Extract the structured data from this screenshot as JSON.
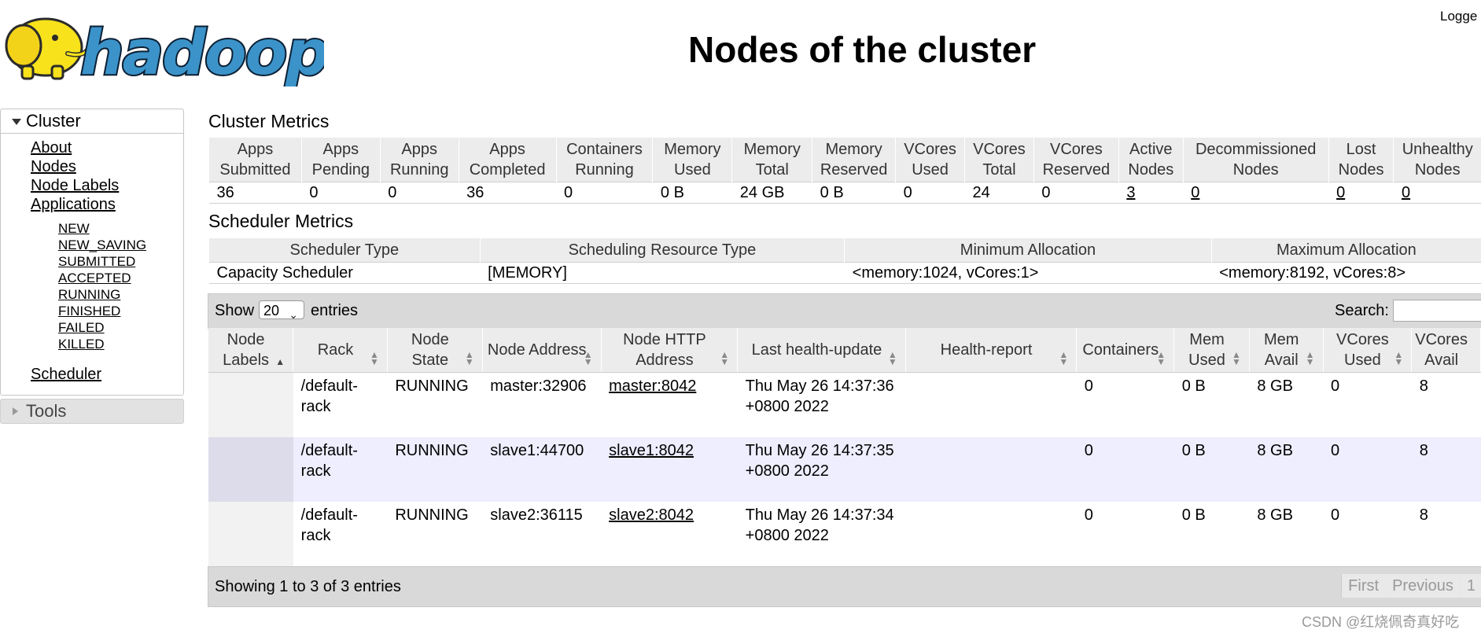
{
  "header": {
    "logo_text": "hadoop",
    "title": "Nodes of the cluster",
    "logged_in": "Logge"
  },
  "nav": {
    "cluster_label": "Cluster",
    "links": [
      "About",
      "Nodes",
      "Node Labels",
      "Applications"
    ],
    "app_states": [
      "NEW",
      "NEW_SAVING",
      "SUBMITTED",
      "ACCEPTED",
      "RUNNING",
      "FINISHED",
      "FAILED",
      "KILLED"
    ],
    "scheduler": "Scheduler",
    "tools_label": "Tools"
  },
  "cluster_metrics": {
    "title": "Cluster Metrics",
    "headers": [
      "Apps Submitted",
      "Apps Pending",
      "Apps Running",
      "Apps Completed",
      "Containers Running",
      "Memory Used",
      "Memory Total",
      "Memory Reserved",
      "VCores Used",
      "VCores Total",
      "VCores Reserved",
      "Active Nodes",
      "Decommissioned Nodes",
      "Lost Nodes",
      "Unhealthy Nodes"
    ],
    "values": [
      "36",
      "0",
      "0",
      "36",
      "0",
      "0 B",
      "24 GB",
      "0 B",
      "0",
      "24",
      "0",
      "3",
      "0",
      "0",
      "0"
    ]
  },
  "scheduler_metrics": {
    "title": "Scheduler Metrics",
    "headers": [
      "Scheduler Type",
      "Scheduling Resource Type",
      "Minimum Allocation",
      "Maximum Allocation"
    ],
    "values": [
      "Capacity Scheduler",
      "[MEMORY]",
      "<memory:1024, vCores:1>",
      "<memory:8192, vCores:8>"
    ]
  },
  "nodes_table": {
    "show_label": "Show",
    "page_size": "20",
    "entries_label": "entries",
    "search_label": "Search:",
    "search_value": "",
    "headers": [
      "Node Labels",
      "Rack",
      "Node State",
      "Node Address",
      "Node HTTP Address",
      "Last health-update",
      "Health-report",
      "Containers",
      "Mem Used",
      "Mem Avail",
      "VCores Used",
      "VCores Avail"
    ],
    "rows": [
      {
        "labels": "",
        "rack": "/default-rack",
        "state": "RUNNING",
        "address": "master:32906",
        "http": "master:8042",
        "health_update": "Thu May 26 14:37:36 +0800 2022",
        "health_report": "",
        "containers": "0",
        "mem_used": "0 B",
        "mem_avail": "8 GB",
        "vcores_used": "0",
        "vcores_avail": "8"
      },
      {
        "labels": "",
        "rack": "/default-rack",
        "state": "RUNNING",
        "address": "slave1:44700",
        "http": "slave1:8042",
        "health_update": "Thu May 26 14:37:35 +0800 2022",
        "health_report": "",
        "containers": "0",
        "mem_used": "0 B",
        "mem_avail": "8 GB",
        "vcores_used": "0",
        "vcores_avail": "8"
      },
      {
        "labels": "",
        "rack": "/default-rack",
        "state": "RUNNING",
        "address": "slave2:36115",
        "http": "slave2:8042",
        "health_update": "Thu May 26 14:37:34 +0800 2022",
        "health_report": "",
        "containers": "0",
        "mem_used": "0 B",
        "mem_avail": "8 GB",
        "vcores_used": "0",
        "vcores_avail": "8"
      }
    ],
    "showing": "Showing 1 to 3 of 3 entries",
    "pager": [
      "First",
      "Previous",
      "1"
    ]
  },
  "watermark": "CSDN @红烧佩奇真好吃",
  "colors": {
    "logo_blue": "#1f6fa8",
    "logo_yellow": "#f7e21b",
    "header_gray": "#ececec",
    "row_alt": "#eeeeff",
    "bar_gray": "#d9d9d9"
  }
}
